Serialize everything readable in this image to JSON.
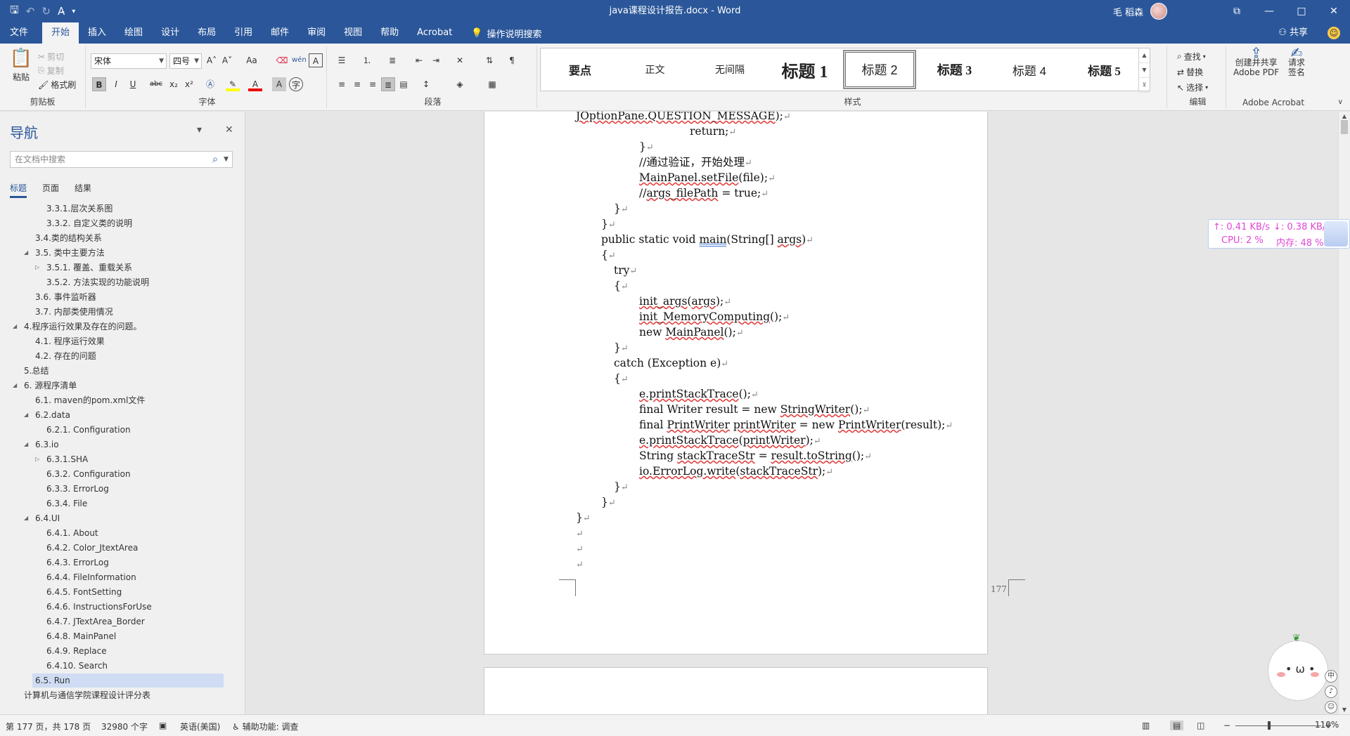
{
  "window": {
    "doc_title": "java课程设计报告.docx  -  Word",
    "user_name": "毛 稻森",
    "controls": [
      "—",
      "⧉",
      "□",
      "✕"
    ]
  },
  "qat": {
    "save": "🖫",
    "undo": "↶",
    "redo": "↻",
    "format": "A̵"
  },
  "tabs": [
    "文件",
    "开始",
    "插入",
    "绘图",
    "设计",
    "布局",
    "引用",
    "邮件",
    "审阅",
    "视图",
    "帮助",
    "Acrobat"
  ],
  "active_tab": "开始",
  "tell_me": "操作说明搜索",
  "share": "共享",
  "ribbon": {
    "clipboard": {
      "paste": "粘贴",
      "cut": "剪切",
      "copy": "复制",
      "format_painter": "格式刷",
      "label": "剪贴板"
    },
    "font": {
      "name": "宋体",
      "size": "四号",
      "label": "字体",
      "grow": "A˄",
      "shrink": "A˅",
      "case": "Aa",
      "bold": "B",
      "italic": "I",
      "underline": "U",
      "strike": "abc",
      "sub": "x₂",
      "sup": "x²"
    },
    "paragraph": {
      "label": "段落"
    },
    "styles": {
      "label": "样式",
      "items": [
        "要点",
        "正文",
        "无间隔",
        "标题 1",
        "标题 2",
        "标题 3",
        "标题 4",
        "标题 5"
      ],
      "selected": "标题 2"
    },
    "editing": {
      "find": "查找",
      "replace": "替换",
      "select": "选择",
      "label": "编辑"
    },
    "acrobat": {
      "create_share": "创建并共享",
      "adobe_pdf": "Adobe PDF",
      "request": "请求",
      "sign": "签名",
      "label": "Adobe Acrobat"
    }
  },
  "nav": {
    "title": "导航",
    "search_placeholder": "在文档中搜索",
    "tabs": [
      "标题",
      "页面",
      "结果"
    ],
    "active_tab": "标题",
    "items": [
      {
        "text": "3.3.1.层次关系图",
        "level": 3,
        "tri": ""
      },
      {
        "text": "3.3.2. 自定义类的说明",
        "level": 3,
        "tri": ""
      },
      {
        "text": "3.4.类的结构关系",
        "level": 2,
        "tri": ""
      },
      {
        "text": "3.5. 类中主要方法",
        "level": 2,
        "tri": "◢"
      },
      {
        "text": "3.5.1. 覆盖、重载关系",
        "level": 3,
        "tri": "▷"
      },
      {
        "text": "3.5.2. 方法实现的功能说明",
        "level": 3,
        "tri": ""
      },
      {
        "text": "3.6. 事件监听器",
        "level": 2,
        "tri": ""
      },
      {
        "text": "3.7. 内部类使用情况",
        "level": 2,
        "tri": ""
      },
      {
        "text": "4.程序运行效果及存在的问题。",
        "level": 1,
        "tri": "◢"
      },
      {
        "text": "4.1. 程序运行效果",
        "level": 2,
        "tri": ""
      },
      {
        "text": "4.2. 存在的问题",
        "level": 2,
        "tri": ""
      },
      {
        "text": "5.总结",
        "level": 1,
        "tri": ""
      },
      {
        "text": "6. 源程序清单",
        "level": 1,
        "tri": "◢"
      },
      {
        "text": "6.1. maven的pom.xml文件",
        "level": 2,
        "tri": ""
      },
      {
        "text": "6.2.data",
        "level": 2,
        "tri": "◢"
      },
      {
        "text": "6.2.1. Configuration",
        "level": 3,
        "tri": ""
      },
      {
        "text": "6.3.io",
        "level": 2,
        "tri": "◢"
      },
      {
        "text": "6.3.1.SHA",
        "level": 3,
        "tri": "▷"
      },
      {
        "text": "6.3.2. Configuration",
        "level": 3,
        "tri": ""
      },
      {
        "text": "6.3.3. ErrorLog",
        "level": 3,
        "tri": ""
      },
      {
        "text": "6.3.4. File",
        "level": 3,
        "tri": ""
      },
      {
        "text": "6.4.UI",
        "level": 2,
        "tri": "◢"
      },
      {
        "text": "6.4.1. About",
        "level": 3,
        "tri": ""
      },
      {
        "text": "6.4.2. Color_JtextArea",
        "level": 3,
        "tri": ""
      },
      {
        "text": "6.4.3. ErrorLog",
        "level": 3,
        "tri": ""
      },
      {
        "text": "6.4.4. FileInformation",
        "level": 3,
        "tri": ""
      },
      {
        "text": "6.4.5. FontSetting",
        "level": 3,
        "tri": ""
      },
      {
        "text": "6.4.6. InstructionsForUse",
        "level": 3,
        "tri": ""
      },
      {
        "text": "6.4.7. JTextArea_Border",
        "level": 3,
        "tri": ""
      },
      {
        "text": "6.4.8. MainPanel",
        "level": 3,
        "tri": ""
      },
      {
        "text": "6.4.9. Replace",
        "level": 3,
        "tri": ""
      },
      {
        "text": "6.4.10. Search",
        "level": 3,
        "tri": ""
      },
      {
        "text": "6.5. Run",
        "level": 2,
        "tri": ""
      },
      {
        "text": "计算机与通信学院课程设计评分表",
        "level": 1,
        "tri": ""
      }
    ],
    "selected": "6.5. Run"
  },
  "document": {
    "page_number": "177",
    "code_lines": [
      {
        "indent": 0,
        "parts": [
          [
            "JOptionPane.QUESTION_MESSAGE",
            "err"
          ],
          [
            ");",
            ""
          ]
        ]
      },
      {
        "indent": 3,
        "parts": [
          [
            "return;",
            ""
          ]
        ]
      },
      {
        "indent": 2,
        "parts": [
          [
            "}",
            ""
          ]
        ]
      },
      {
        "indent": 2,
        "parts": [
          [
            "//通过验证，开始处理",
            ""
          ]
        ]
      },
      {
        "indent": 2,
        "parts": [
          [
            "MainPanel.setFile",
            "err"
          ],
          [
            "(file);",
            ""
          ]
        ]
      },
      {
        "indent": 2,
        "parts": [
          [
            "//",
            ""
          ],
          [
            "args_filePath",
            "err"
          ],
          [
            " = true;",
            ""
          ]
        ]
      },
      {
        "indent": 1.5,
        "parts": [
          [
            "}",
            ""
          ]
        ]
      },
      {
        "indent": 1,
        "parts": [
          [
            "}",
            ""
          ]
        ]
      },
      {
        "indent": 1,
        "parts": [
          [
            "public static void ",
            ""
          ],
          [
            "main",
            "blu"
          ],
          [
            "(String[] ",
            ""
          ],
          [
            "args",
            "err"
          ],
          [
            ")",
            ""
          ]
        ]
      },
      {
        "indent": 1,
        "parts": [
          [
            "{",
            ""
          ]
        ]
      },
      {
        "indent": 1.5,
        "parts": [
          [
            "try",
            ""
          ]
        ]
      },
      {
        "indent": 1.5,
        "parts": [
          [
            "{",
            ""
          ]
        ]
      },
      {
        "indent": 2,
        "parts": [
          [
            "init_args",
            "err"
          ],
          [
            "(",
            ""
          ],
          [
            "args",
            "err"
          ],
          [
            ");",
            ""
          ]
        ]
      },
      {
        "indent": 2,
        "parts": [
          [
            "init_MemoryComputing",
            "err"
          ],
          [
            "();",
            ""
          ]
        ]
      },
      {
        "indent": 2,
        "parts": [
          [
            "new ",
            ""
          ],
          [
            "MainPanel",
            "err"
          ],
          [
            "();",
            ""
          ]
        ]
      },
      {
        "indent": 1.5,
        "parts": [
          [
            "}",
            ""
          ]
        ]
      },
      {
        "indent": 1.5,
        "parts": [
          [
            "catch (Exception e)",
            ""
          ]
        ]
      },
      {
        "indent": 1.5,
        "parts": [
          [
            "{",
            ""
          ]
        ]
      },
      {
        "indent": 2,
        "parts": [
          [
            "e.printStackTrace",
            "err"
          ],
          [
            "();",
            ""
          ]
        ]
      },
      {
        "indent": 2,
        "parts": [
          [
            "final Writer result = new ",
            ""
          ],
          [
            "StringWriter",
            "err"
          ],
          [
            "();",
            ""
          ]
        ]
      },
      {
        "indent": 2,
        "parts": [
          [
            "final ",
            ""
          ],
          [
            "PrintWriter",
            "err"
          ],
          [
            " ",
            ""
          ],
          [
            "printWriter",
            "err"
          ],
          [
            " = new ",
            ""
          ],
          [
            "PrintWriter",
            "err"
          ],
          [
            "(result);",
            ""
          ]
        ]
      },
      {
        "indent": 2,
        "parts": [
          [
            "e.printStackTrace",
            "err"
          ],
          [
            "(",
            ""
          ],
          [
            "printWriter",
            "err"
          ],
          [
            ");",
            ""
          ]
        ]
      },
      {
        "indent": 2,
        "parts": [
          [
            "String ",
            ""
          ],
          [
            "stackTraceStr",
            "err"
          ],
          [
            " = ",
            ""
          ],
          [
            "result.toString",
            "err"
          ],
          [
            "();",
            ""
          ]
        ]
      },
      {
        "indent": 2,
        "parts": [
          [
            "io.ErrorLog.write",
            "err"
          ],
          [
            "(",
            ""
          ],
          [
            "stackTraceStr",
            "err"
          ],
          [
            ");",
            ""
          ]
        ]
      },
      {
        "indent": 1.5,
        "parts": [
          [
            "}",
            ""
          ]
        ]
      },
      {
        "indent": 1,
        "parts": [
          [
            "}",
            ""
          ]
        ]
      },
      {
        "indent": 0,
        "parts": [
          [
            "}",
            ""
          ]
        ]
      },
      {
        "indent": 0,
        "parts": [
          [
            "",
            ""
          ]
        ]
      },
      {
        "indent": 0,
        "parts": [
          [
            "",
            ""
          ]
        ]
      },
      {
        "indent": 0,
        "parts": [
          [
            "",
            ""
          ]
        ]
      }
    ],
    "para_mark": "↵"
  },
  "net_widget": {
    "up": "↑: 0.41 KB/s",
    "down": "↓: 0.38 KB/s",
    "cpu": "CPU: 2 %",
    "mem": "内存: 48 %"
  },
  "mascot": {
    "face": "• ω •"
  },
  "side_buttons": [
    "中",
    "♪",
    "☺"
  ],
  "status": {
    "page": "第 177 页，共 178 页",
    "words": "32980 个字",
    "lang": "英语(美国)",
    "accessibility": "辅助功能: 调查",
    "zoom": "110%",
    "zoom_minus": "−",
    "zoom_plus": "+"
  },
  "colors": {
    "ribbon_blue": "#2b579a",
    "error_underline": "#e23b3b",
    "widget_text": "#e046d6"
  }
}
